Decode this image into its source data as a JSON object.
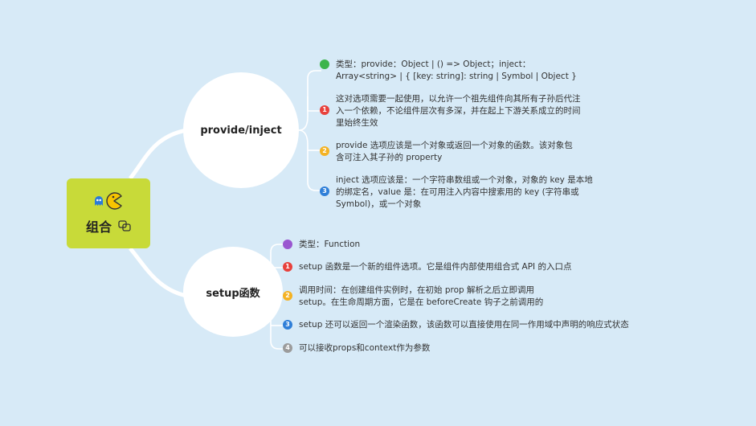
{
  "root": {
    "title": "组合"
  },
  "topics": [
    {
      "label": "provide/inject",
      "items": [
        {
          "marker": "",
          "color": "#3cb44b",
          "text": "类型：provide：Object | () => Object；inject：Array<string> | { [key: string]: string | Symbol | Object }"
        },
        {
          "marker": "1",
          "color": "#e8413c",
          "text": "这对选项需要一起使用，以允许一个祖先组件向其所有子孙后代注入一个依赖，不论组件层次有多深，并在起上下游关系成立的时间里始终生效"
        },
        {
          "marker": "2",
          "color": "#f4b223",
          "text": "provide 选项应该是一个对象或返回一个对象的函数。该对象包含可注入其子孙的 property"
        },
        {
          "marker": "3",
          "color": "#2f7fd8",
          "text": "inject 选项应该是：一个字符串数组或一个对象，对象的 key 是本地的绑定名，value 是：在可用注入内容中搜索用的 key (字符串或 Symbol)，或一个对象"
        }
      ]
    },
    {
      "label": "setup函数",
      "items": [
        {
          "marker": "",
          "color": "#9a57d0",
          "text": "类型：Function"
        },
        {
          "marker": "1",
          "color": "#e8413c",
          "text": "setup 函数是一个新的组件选项。它是组件内部使用组合式 API 的入口点"
        },
        {
          "marker": "2",
          "color": "#f4b223",
          "text": "调用时间：在创建组件实例时，在初始 prop 解析之后立即调用 setup。在生命周期方面，它是在 beforeCreate 钩子之前调用的"
        },
        {
          "marker": "3",
          "color": "#2f7fd8",
          "text": "setup 还可以返回一个渲染函数，该函数可以直接使用在同一作用域中声明的响应式状态"
        },
        {
          "marker": "4",
          "color": "#9b9b9b",
          "text": "可以接收props和context作为参数"
        }
      ]
    }
  ]
}
